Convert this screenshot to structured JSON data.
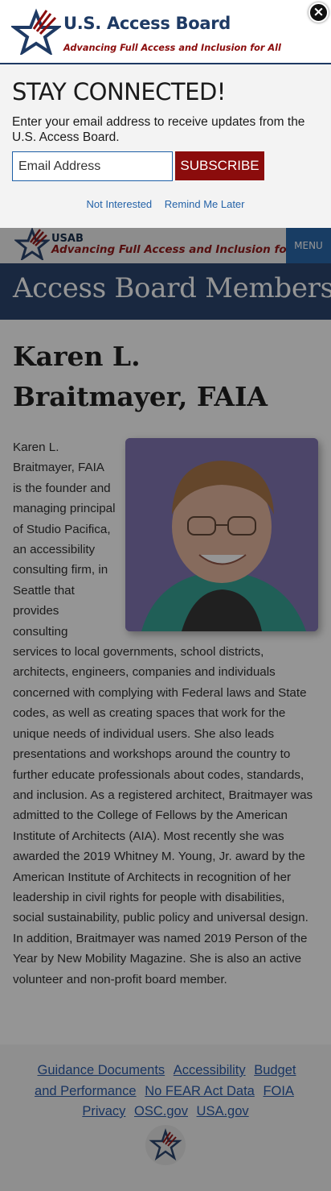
{
  "popup": {
    "brand": "U.S. Access Board",
    "tagline": "Advancing Full Access and Inclusion for All",
    "close_label": "×",
    "title": "STAY CONNECTED!",
    "description": "Enter your email address to receive updates from the U.S. Access Board.",
    "email_placeholder": "Email Address",
    "subscribe_label": "SUBSCRIBE",
    "not_interested_label": "Not Interested",
    "remind_later_label": "Remind Me Later"
  },
  "header": {
    "abbr": "USAB",
    "tagline": "Advancing Full Access and Inclusion for All",
    "menu_label": "MENU"
  },
  "banner": {
    "title": "Access Board Members"
  },
  "member": {
    "name": "Karen L. Braitmayer, FAIA",
    "bio": "Karen L. Braitmayer, FAIA is the founder and managing principal of Studio Pacifica, an accessibility consulting firm, in Seattle that provides consulting services to local governments, school districts, architects, engineers, companies and individuals concerned with complying with Federal laws and State codes, as well as creating spaces that work for the unique needs of individual users. She also leads presentations and workshops around the country to further educate professionals about codes, standards, and inclusion. As a registered architect, Braitmayer was admitted to the College of Fellows by the American Institute of Architects (AIA). Most recently she was awarded the 2019 Whitney M. Young, Jr. award by the American Institute of Architects in recognition of her leadership in civil rights for people with disabilities, social sustainability, public policy and universal design. In addition, Braitmayer was named 2019 Person of the Year by New Mobility Magazine. She is also an active volunteer and non-profit board member."
  },
  "footer": {
    "links": [
      "Guidance Documents",
      "Accessibility",
      "Budget and Performance",
      "No FEAR Act Data",
      "FOIA",
      "Privacy",
      "OSC.gov",
      "USA.gov"
    ]
  },
  "colors": {
    "navy": "#1e3a64",
    "crimson": "#8b0c0c",
    "link_blue": "#1d4fa1",
    "menu_blue": "#1d5fa6"
  }
}
